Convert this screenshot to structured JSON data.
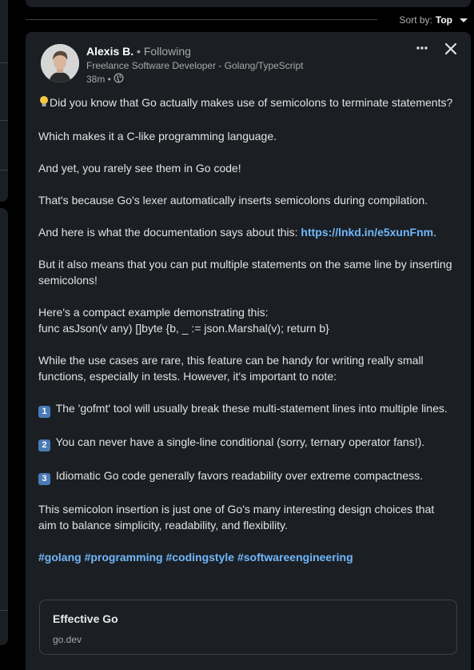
{
  "feed": {
    "sort_label": "Sort by:",
    "sort_value": "Top"
  },
  "post": {
    "author_name": "Alexis B.",
    "follow_status": "• Following",
    "headline": "Freelance Software Developer - Golang/TypeScript",
    "time": "38m •",
    "visibility_icon": "globe-icon",
    "paragraphs": {
      "p1": "Did you know that Go actually makes use of semicolons to terminate statements?",
      "p2": "Which makes it a C-like programming language.",
      "p3": "And yet, you rarely see them in Go code!",
      "p4": "That's because Go's lexer automatically inserts semicolons during compilation.",
      "p5_text": "And here is what the documentation says about this: ",
      "p5_link": "https://lnkd.in/e5xunFnm",
      "p5_end": ".",
      "p6": "But it also means that you can put multiple statements on the same line by inserting semicolons!",
      "p7_line1": "Here's a compact example demonstrating this:",
      "p7_line2": "func asJson(v any) []byte {b, _ := json.Marshal(v); return b}",
      "p8": "While the use cases are rare, this feature can be handy for writing really small functions, especially in tests. However, it's important to note:",
      "item1_num": "1",
      "item1": "The 'gofmt' tool will usually break these multi-statement lines into multiple lines.",
      "item2_num": "2",
      "item2": "You can never have a single-line conditional (sorry, ternary operator fans!).",
      "item3_num": "3",
      "item3": "Idiomatic Go code generally favors readability over extreme compactness.",
      "p9": "This semicolon insertion is just one of Go's many interesting design choices that aim to balance simplicity, readability, and flexibility."
    },
    "hashtags": [
      "#golang",
      "#programming",
      "#codingstyle",
      "#softwareengineering"
    ],
    "link_preview": {
      "title": "Effective Go",
      "domain": "go.dev"
    }
  },
  "colors": {
    "background": "#000000",
    "card": "#1b1f23",
    "link": "#71b7fb",
    "muted": "#a8a8a8"
  }
}
